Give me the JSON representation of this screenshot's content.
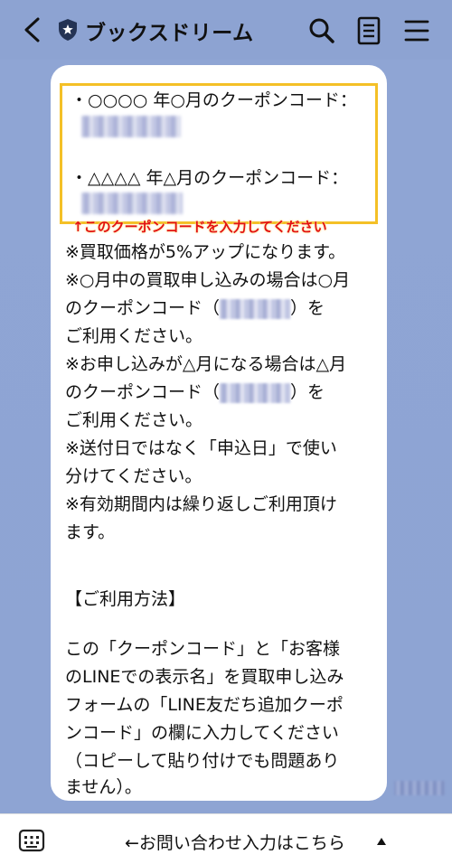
{
  "header": {
    "title": "ブックスドリーム",
    "icons": [
      "back-icon",
      "shield-icon",
      "search-icon",
      "note-icon",
      "menu-icon"
    ]
  },
  "message": {
    "coupon_line_1": "・○○○○ 年○月のクーポンコード：",
    "coupon_line_2": "・△△△△ 年△月のクーポンコード：",
    "annotation": "↑このクーポンコードを入力してください",
    "lines": [
      "※買取価格が5%アップになります。",
      "※○月中の買取申し込みの場合は○月",
      "ご利用ください。",
      "※お申し込みが△月になる場合は△月",
      "ご利用ください。",
      "※送付日ではなく「申込日」で使い",
      "分けてください。",
      "※有効期間内は繰り返しご利用頂け",
      "ます。",
      "【ご利用方法】",
      "この「クーポンコード」と「お客様",
      "のLINEでの表示名」を買取申し込み",
      "フォームの「LINE友だち追加クーポ",
      "ンコード」の欄に入力してください",
      "（コピーして貼り付けでも問題あり",
      "ません）。"
    ],
    "coupon_ref_1_prefix": "のクーポンコード（",
    "coupon_ref_1_suffix": "）を",
    "coupon_ref_2_prefix": "のクーポンコード（",
    "coupon_ref_2_suffix": "）を"
  },
  "footer": {
    "label": "←お問い合わせ入力はこちら",
    "icons": [
      "keyboard-icon",
      "triangle-up-icon"
    ]
  },
  "colors": {
    "background": "#8da3d2",
    "bubble": "#ffffff",
    "highlight_border": "#f4c027",
    "annotation": "#e31212"
  }
}
